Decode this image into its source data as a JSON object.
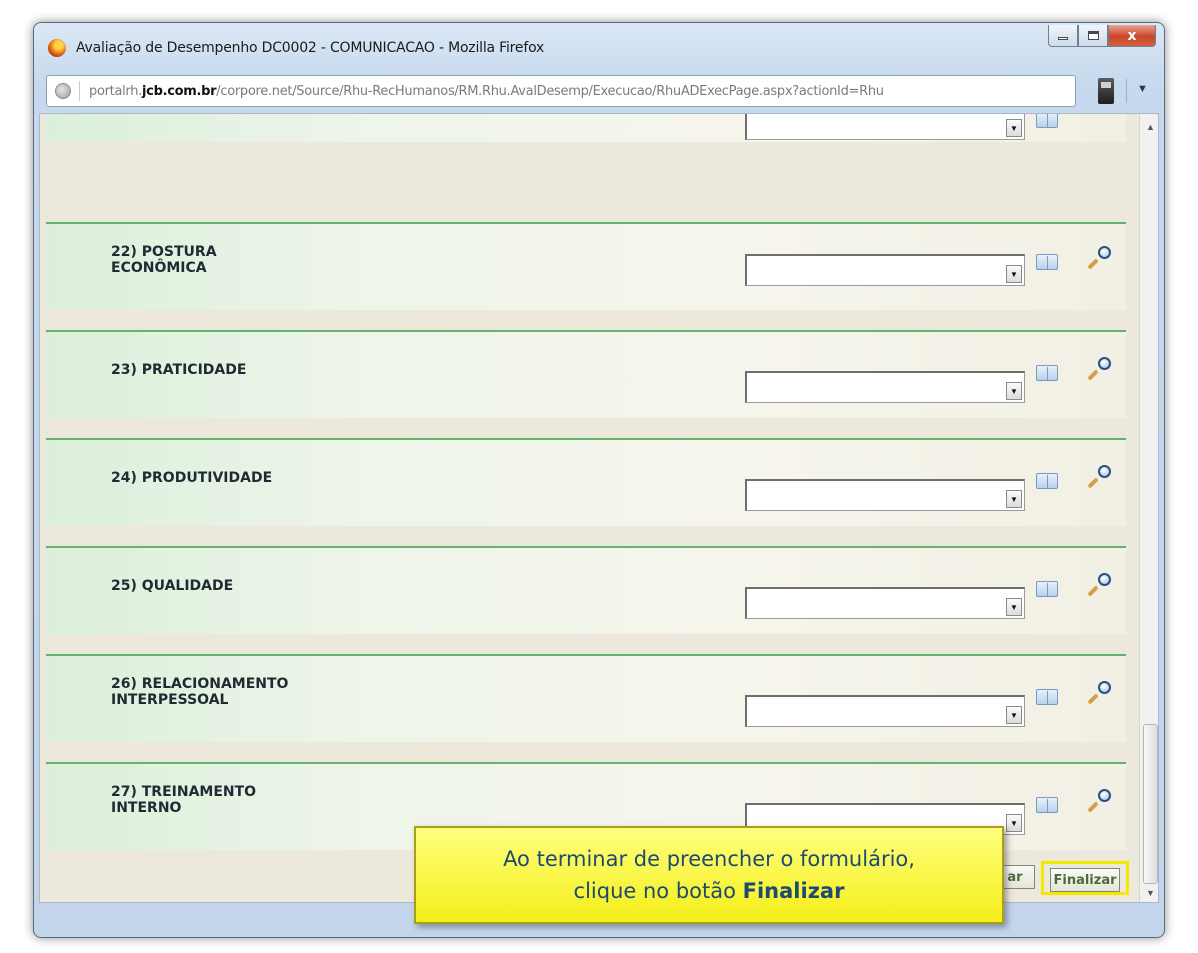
{
  "window": {
    "title": "Avaliação de Desempenho DC0002 - COMUNICACAO - Mozilla Firefox",
    "icon": "firefox-icon",
    "controls": {
      "minimize": "minimize-icon",
      "maximize": "maximize-icon",
      "close": "x"
    }
  },
  "addressbar": {
    "url_prefix": "portalrh.",
    "url_domain": "jcb.com.br",
    "url_path": "/corpore.net/Source/Rhu-RecHumanos/RM.Rhu.AvalDesemp/Execucao/RhuADExecPage.aspx?actionId=Rhu"
  },
  "questions": [
    {
      "line1": "22) POSTURA",
      "line2": "ECONÔMICA",
      "value": ""
    },
    {
      "line1": "23) PRATICIDADE",
      "line2": "",
      "value": ""
    },
    {
      "line1": "24) PRODUTIVIDADE",
      "line2": "",
      "value": ""
    },
    {
      "line1": "25) QUALIDADE",
      "line2": "",
      "value": ""
    },
    {
      "line1": "26) RELACIONAMENTO",
      "line2": "INTERPESSOAL",
      "value": ""
    },
    {
      "line1": "27) TREINAMENTO",
      "line2": "INTERNO",
      "value": ""
    }
  ],
  "buttons": {
    "partial_label": "ar",
    "finish_label": "Finalizar"
  },
  "callout": {
    "line1": "Ao terminar de preencher o formulário,",
    "line2_prefix": "clique no botão ",
    "line2_bold": "Finalizar"
  },
  "colors": {
    "section_border": "#62b46a",
    "callout_bg": "#f4ee18",
    "callout_text": "#1d4a73"
  }
}
